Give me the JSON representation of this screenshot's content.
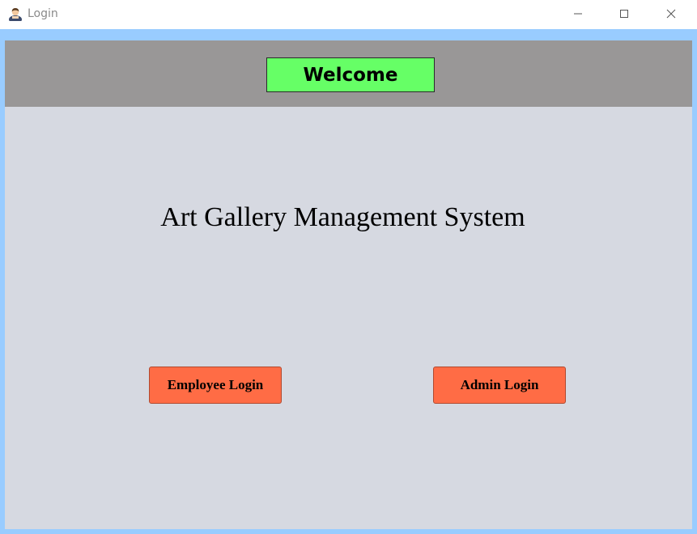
{
  "window": {
    "title": "Login",
    "app_icon": "user-icon",
    "controls": {
      "minimize_icon": "minimize-icon",
      "maximize_icon": "maximize-icon",
      "close_icon": "close-icon"
    }
  },
  "header": {
    "welcome_label": "Welcome",
    "band_color": "#999797",
    "label_color": "#66ff66"
  },
  "main": {
    "title": "Art Gallery Management System",
    "background_color": "#d6d9e1"
  },
  "buttons": {
    "employee_login": "Employee Login",
    "admin_login": "Admin Login",
    "color": "#ff6c45"
  }
}
